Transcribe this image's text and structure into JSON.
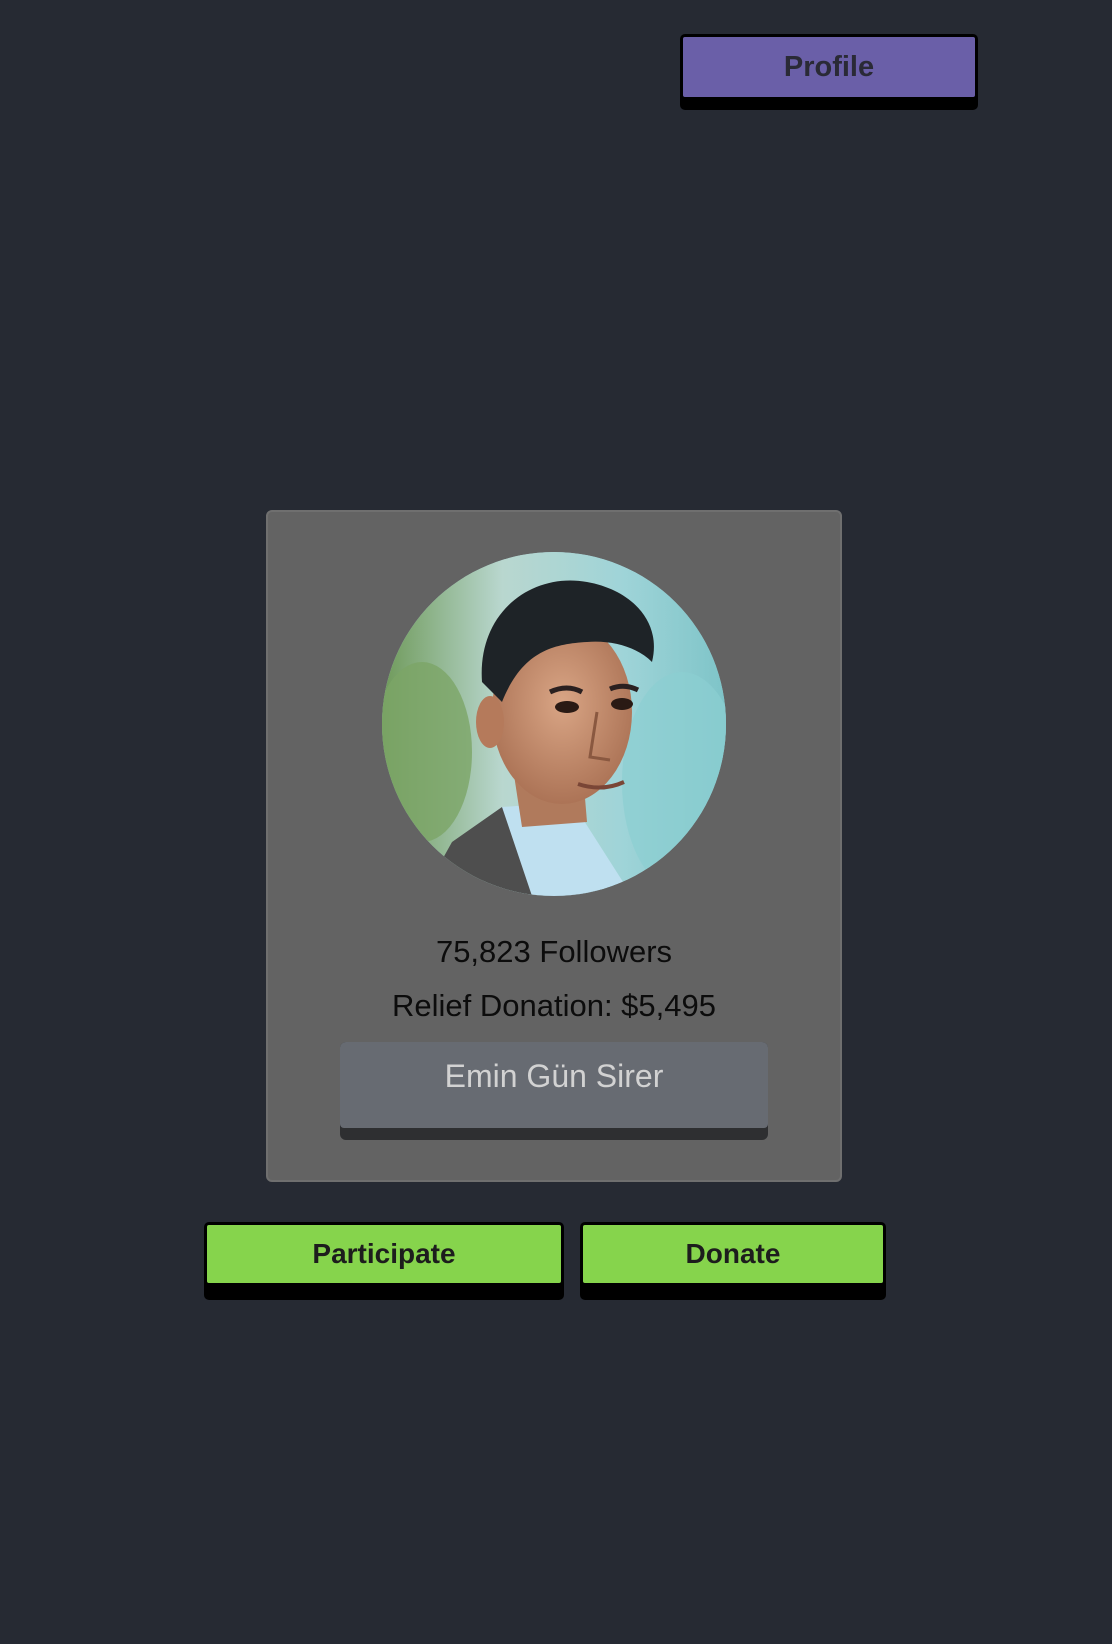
{
  "header": {
    "profile_label": "Profile"
  },
  "card": {
    "avatar_icon": "person-portrait",
    "followers_text": "75,823 Followers",
    "donation_text": "Relief Donation: $5,495",
    "name_label": "Emin Gün Sirer"
  },
  "actions": {
    "participate_label": "Participate",
    "donate_label": "Donate"
  },
  "colors": {
    "background": "#262a33",
    "profile_button": "#6a5fa8",
    "card": "#636363",
    "name_button": "#676b72",
    "action_button": "#86d44c"
  }
}
